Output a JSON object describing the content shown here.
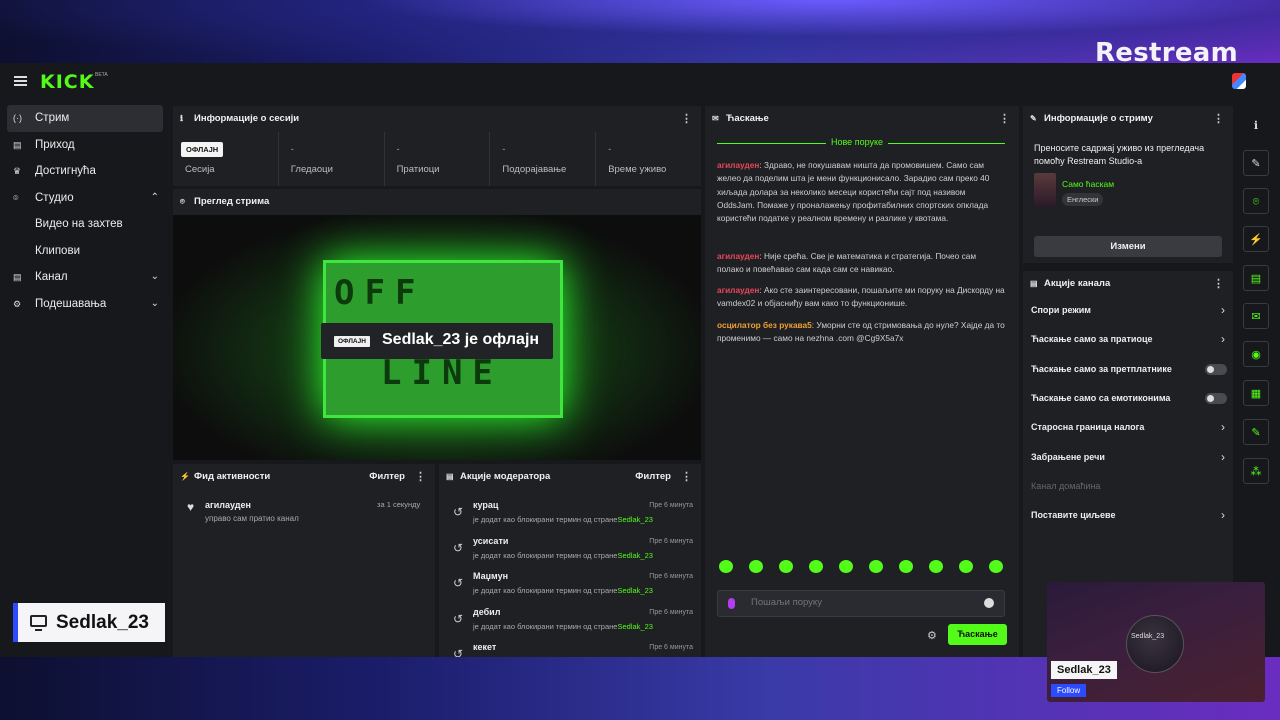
{
  "brand": "Restream",
  "logo": "KICK",
  "logo_beta": "BETA",
  "sidebar": {
    "items": [
      {
        "icon": "(·)",
        "label": "Стрим",
        "active": true
      },
      {
        "icon": "▤",
        "label": "Приход"
      },
      {
        "icon": "♛",
        "label": "Достигнућа"
      },
      {
        "icon": "⌾",
        "label": "Студио",
        "chevron": "⌃"
      },
      {
        "label": "Видео на захтев",
        "sub": true
      },
      {
        "label": "Клипови",
        "sub": true
      },
      {
        "icon": "▤",
        "label": "Канал",
        "chevron": "⌄"
      },
      {
        "icon": "⚙",
        "label": "Подешавања",
        "chevron": "⌄"
      }
    ]
  },
  "session": {
    "title": "Информације о сесији",
    "status_badge": "ОФЛАЈН",
    "stats": [
      {
        "label": "Сесија",
        "value": ""
      },
      {
        "label": "Гледаоци",
        "value": "-"
      },
      {
        "label": "Пратиоци",
        "value": "-"
      },
      {
        "label": "Подорајавање",
        "value": "-"
      },
      {
        "label": "Време уживо",
        "value": "-"
      }
    ]
  },
  "preview": {
    "title": "Преглед стрима",
    "badge": "ОФЛАЈН",
    "text": "Sedlak_23 је офлајн",
    "art_top": "OFF",
    "art_bottom": "LINE"
  },
  "activity": {
    "title": "Фид активности",
    "filter": "Филтер",
    "items": [
      {
        "user": "агилауден",
        "text": "управо сам пратио канал",
        "time": "за 1 секунду"
      }
    ]
  },
  "moderator": {
    "title": "Акције модератора",
    "filter": "Филтер",
    "items": [
      {
        "word": "курац",
        "time": "Пре 6 минута",
        "text": "је додат као блокирани термин од стране",
        "by": "Sedlak_23"
      },
      {
        "word": "усисати",
        "time": "Пре 6 минута",
        "text": "је додат као блокирани термин од стране",
        "by": "Sedlak_23"
      },
      {
        "word": "Маџмун",
        "time": "Пре 6 минута",
        "text": "је додат као блокирани термин од стране",
        "by": "Sedlak_23"
      },
      {
        "word": "дебил",
        "time": "Пре 6 минута",
        "text": "је додат као блокирани термин од стране",
        "by": "Sedlak_23"
      },
      {
        "word": "кекет",
        "time": "Пре 6 минута",
        "text": "",
        "by": ""
      }
    ]
  },
  "chat": {
    "title": "Ћаскање",
    "new_messages": "Нове поруке",
    "messages": [
      {
        "user": "агилауден",
        "color": "#e8475a",
        "text": "Здраво, не покушавам ништа да промовишем. Само сам желео да поделим шта је мени функционисало. Зарадио сам преко 40 хиљада долара за неколико месеци користећи сајт под називом OddsJam. Помаже у проналажењу профитабилних спортских опклада користећи податке у реалном времену и разлике у квотама."
      },
      {
        "user": "агилауден",
        "color": "#e8475a",
        "text": "Није срећа. Све је математика и стратегија. Почео сам полако и повећавао сам када сам се навикао."
      },
      {
        "user": "агилауден",
        "color": "#e8475a",
        "text": "Ако сте заинтересовани, пошаљите ми поруку на Дискорду на vamdex02 и објасниђу вам како то функционише."
      },
      {
        "user": "осцилатор без рукава5",
        "color": "#f0a030",
        "text": "Уморни сте од стримовања до нуле? Хајде да то променимо — само на nezhna .com @Cg9X5a7x"
      }
    ],
    "input_placeholder": "Пошаљи поруку",
    "send_label": "Ћаскање"
  },
  "stream_info": {
    "title": "Информације о стриму",
    "text": "Преносите садржај уживо из прегледача помоћу Restream Studio-а",
    "category": "Само ћаскам",
    "tag": "Енглески",
    "edit_label": "Измени"
  },
  "channel_actions": {
    "title": "Акције канала",
    "items": [
      {
        "label": "Спори режим",
        "control": "arrow"
      },
      {
        "label": "Ћаскање само за пратиоце",
        "control": "arrow"
      },
      {
        "label": "Ћаскање само за претплатнике",
        "control": "toggle"
      },
      {
        "label": "Ћаскање само са емотиконима",
        "control": "toggle"
      },
      {
        "label": "Старосна граница налога",
        "control": "arrow"
      },
      {
        "label": "Забрањене речи",
        "control": "arrow"
      },
      {
        "label": "Канал домаћина",
        "control": "none",
        "disabled": true
      },
      {
        "label": "Поставите циљеве",
        "control": "arrow"
      }
    ]
  },
  "rightbar_icons": [
    "info-icon",
    "pencil-icon",
    "camera-icon",
    "bolt-icon",
    "document-icon",
    "chat-icon",
    "broadcast-icon",
    "layout-icon",
    "wrench-icon",
    "puzzle-icon"
  ],
  "overlay": {
    "name_tag": "Sedlak_23",
    "cam_text": "Sedlak_23",
    "cam_name": "Sedlak_23",
    "follow": "Follow"
  },
  "colors": {
    "accent": "#53fc18",
    "panel": "#1f2024",
    "bg": "#17181c",
    "restream_blue": "#2c4bff"
  }
}
